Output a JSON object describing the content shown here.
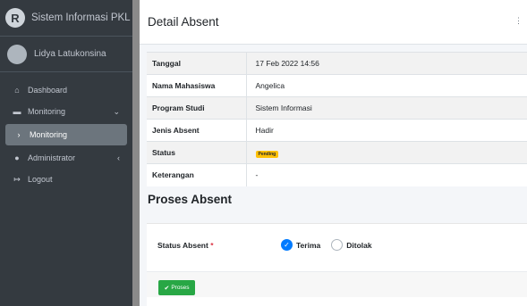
{
  "brand": {
    "logo_letter": "R",
    "name": "Sistem Informasi PKL"
  },
  "user": {
    "name": "Lidya Latukonsina"
  },
  "sidebar": {
    "items": [
      {
        "icon": "home-icon",
        "glyph": "⌂",
        "label": "Dashboard"
      },
      {
        "icon": "chart-icon",
        "glyph": "▬",
        "label": "Monitoring",
        "arrow": "⌄"
      },
      {
        "icon": "chevron-right-icon",
        "glyph": "›",
        "label": "Monitoring"
      },
      {
        "icon": "user-icon",
        "glyph": "●",
        "label": "Administrator",
        "arrow": "‹"
      },
      {
        "icon": "logout-icon",
        "glyph": "↦",
        "label": "Logout"
      }
    ]
  },
  "header": {
    "title": "Detail Absent",
    "menu": "⋮"
  },
  "detail": {
    "rows": [
      {
        "label": "Tanggal",
        "value": "17 Feb 2022 14:56"
      },
      {
        "label": "Nama Mahasiswa",
        "value": "Angelica"
      },
      {
        "label": "Program Studi",
        "value": "Sistem Informasi"
      },
      {
        "label": "Jenis Absent",
        "value": "Hadir"
      },
      {
        "label": "Status",
        "value": "Pending"
      },
      {
        "label": "Keterangan",
        "value": "-"
      }
    ]
  },
  "proses": {
    "title": "Proses Absent",
    "status_label": "Status Absent",
    "required_mark": "*",
    "options": [
      {
        "label": "Terima",
        "checked": true
      },
      {
        "label": "Ditolak",
        "checked": false
      }
    ],
    "button_label": "Proses",
    "button_icon": "✔"
  },
  "colors": {
    "sidebar": "#343a40",
    "active": "#6c757d",
    "primary": "#007bff",
    "success": "#28a745",
    "warning": "#ffc107"
  }
}
